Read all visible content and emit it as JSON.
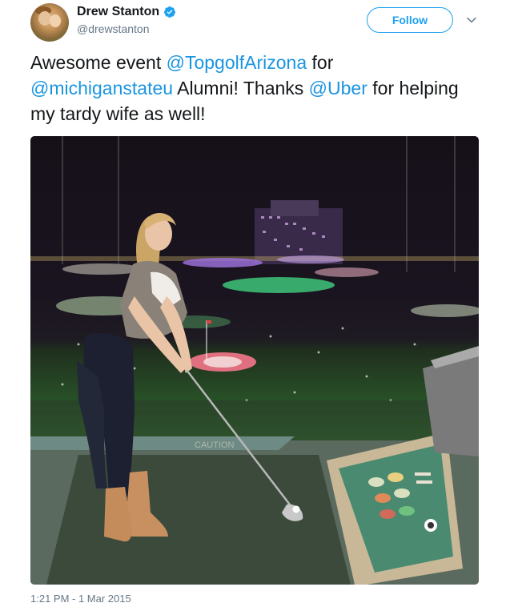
{
  "author": {
    "display_name": "Drew Stanton",
    "handle": "@drewstanton",
    "verified": true
  },
  "actions": {
    "follow_label": "Follow",
    "more_icon": "chevron-down-icon"
  },
  "tweet": {
    "segments": [
      {
        "text": "Awesome event ",
        "mention": false
      },
      {
        "text": "@TopgolfArizona",
        "mention": true
      },
      {
        "text": " for ",
        "mention": false
      },
      {
        "text": "@michiganstateu",
        "mention": true
      },
      {
        "text": " Alumni! Thanks ",
        "mention": false
      },
      {
        "text": "@Uber",
        "mention": true
      },
      {
        "text": " for helping my tardy wife as well!",
        "mention": false
      }
    ]
  },
  "media": {
    "signs": {
      "caution": "CAUTION"
    }
  },
  "timestamp": "1:21 PM - 1 Mar 2015",
  "colors": {
    "link": "#1b95e0",
    "follow": "#1da1f2",
    "secondary_text": "#657786",
    "verified": "#1da1f2"
  }
}
